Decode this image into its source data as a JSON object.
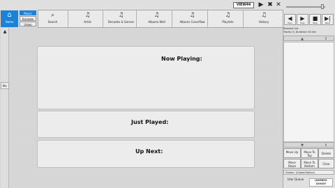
{
  "top": {
    "logo_text": "VIEW44",
    "controls": [
      {
        "name": "play-icon",
        "glyph": "▶"
      },
      {
        "name": "tools-icon",
        "glyph": "✖"
      },
      {
        "name": "close-icon",
        "glyph": "✕"
      }
    ]
  },
  "home": {
    "label": "Home",
    "icon": "⌂"
  },
  "modes": [
    {
      "label": "Music",
      "active": true
    },
    {
      "label": "Karaoke",
      "active": false
    },
    {
      "label": "Video",
      "active": false
    }
  ],
  "nav": [
    {
      "label": "Search",
      "icon": "⌕"
    },
    {
      "label": "Artist",
      "icon": "♫"
    },
    {
      "label": "Decades & Genres",
      "icon": "♫"
    },
    {
      "label": "Albums Wall",
      "icon": "♫"
    },
    {
      "label": "Albums Coverflow",
      "icon": "♫"
    },
    {
      "label": "Playlists",
      "icon": "♫"
    },
    {
      "label": "History",
      "icon": "♫"
    }
  ],
  "left": {
    "mic_label": "Mic",
    "up_arrow": "▲"
  },
  "panels": {
    "now_playing": "Now Playing:",
    "just_played": "Just Played:",
    "up_next": "Up Next:"
  },
  "transport": [
    {
      "glyph": "◀",
      "label": "Prev"
    },
    {
      "glyph": "▶",
      "label": "Play"
    },
    {
      "glyph": "■",
      "label": "Stop"
    },
    {
      "glyph": "▶|",
      "label": "Next"
    }
  ],
  "queue": {
    "requests_line": "Request List",
    "tracks_line": "Tracks: 0, Duration: 00 min",
    "up_arrow": "▲",
    "down_arrow": "▼",
    "sort_icon": "⇕",
    "buttons": [
      {
        "label": "Move Up"
      },
      {
        "label": "Move To Top"
      },
      {
        "label": "Delete"
      },
      {
        "label": "Move Down"
      },
      {
        "label": "Move To Bottom"
      },
      {
        "label": "Clear"
      }
    ]
  },
  "station": "Station: (Global/Station)",
  "user_queue": "User Queue",
  "brand": {
    "line1": "JUKEBOX",
    "line2": "DOGGY"
  }
}
